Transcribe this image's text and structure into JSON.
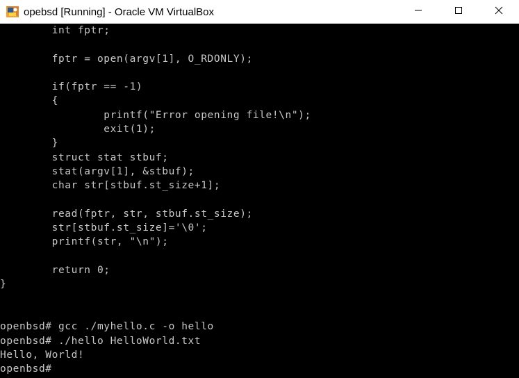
{
  "window": {
    "title": "opebsd [Running] - Oracle VM VirtualBox",
    "app_icon": "virtualbox-icon",
    "controls": [
      "minimize-icon",
      "maximize-icon",
      "close-icon"
    ]
  },
  "terminal": {
    "fg_color": "#c8c8c8",
    "bg_color": "#000000",
    "lines": [
      "        int fptr;",
      "",
      "        fptr = open(argv[1], O_RDONLY);",
      "",
      "        if(fptr == -1)",
      "        {",
      "                printf(\"Error opening file!\\n\");",
      "                exit(1);",
      "        }",
      "        struct stat stbuf;",
      "        stat(argv[1], &stbuf);",
      "        char str[stbuf.st_size+1];",
      "",
      "        read(fptr, str, stbuf.st_size);",
      "        str[stbuf.st_size]='\\0';",
      "        printf(str, \"\\n\");",
      "",
      "        return 0;",
      "}",
      "",
      "",
      "openbsd# gcc ./myhello.c -o hello",
      "openbsd# ./hello HelloWorld.txt",
      "Hello, World!",
      "openbsd#"
    ]
  }
}
